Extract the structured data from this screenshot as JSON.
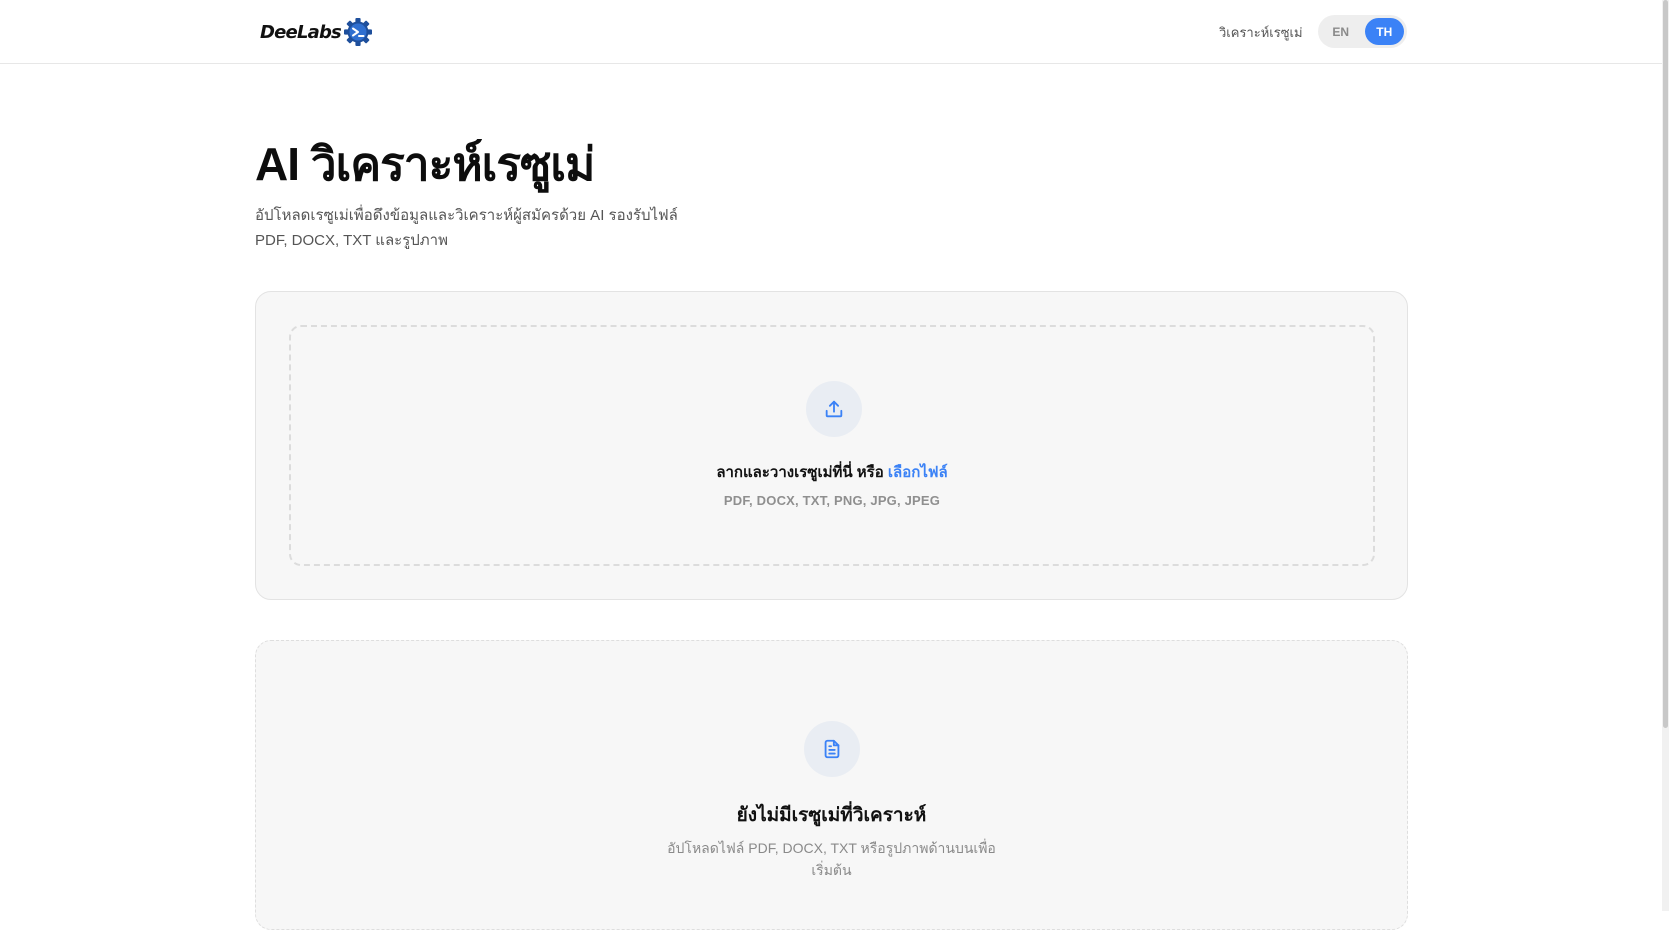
{
  "header": {
    "logo_text": "DeeLabs",
    "nav_link": "วิเคราะห์เรซูเม่",
    "lang": {
      "en": "EN",
      "th": "TH",
      "selected": "TH"
    }
  },
  "hero": {
    "title": "AI วิเคราะห์เรซูเม่",
    "subtitle": "อัปโหลดเรซูเม่เพื่อดึงข้อมูลและวิเคราะห์ผู้สมัครด้วย AI รองรับไฟล์ PDF, DOCX, TXT และรูปภาพ"
  },
  "upload": {
    "icon": "upload-icon",
    "prompt": "ลากและวางเรซูเม่ที่นี่ หรือ ",
    "link_text": "เลือกไฟล์",
    "formats": "PDF, DOCX, TXT, PNG, JPG, JPEG"
  },
  "empty_state": {
    "icon": "document-icon",
    "title": "ยังไม่มีเรซูเม่ที่วิเคราะห์",
    "description": "อัปโหลดไฟล์ PDF, DOCX, TXT หรือรูปภาพด้านบนเพื่อเริ่มต้น"
  },
  "colors": {
    "accent": "#3b82f6",
    "card_bg": "#f7f7f7",
    "icon_circle": "#e9edf3"
  }
}
